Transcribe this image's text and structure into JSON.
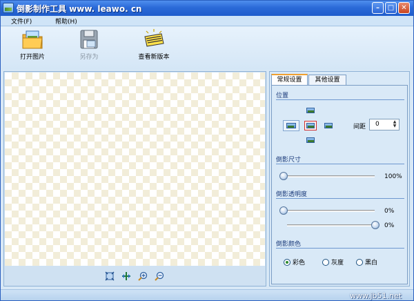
{
  "window": {
    "title": "倒影制作工具 www. leawo. cn",
    "minimize_icon": "minimize-icon",
    "maximize_icon": "maximize-icon",
    "close_icon": "close-icon"
  },
  "menu": {
    "file": "文件(F)",
    "help": "帮助(H)"
  },
  "toolbar": {
    "open_label": "打开图片",
    "saveas_label": "另存为",
    "new_version_label": "查看新版本",
    "open_icon": "folder-image-icon",
    "saveas_icon": "floppy-disk-icon",
    "new_version_icon": "new-version-badge-icon"
  },
  "preview": {
    "zoom_buttons": [
      "fit-to-window-icon",
      "actual-size-icon",
      "zoom-in-icon",
      "zoom-out-icon"
    ]
  },
  "settings": {
    "tabs": [
      {
        "label": "常规设置",
        "active": true
      },
      {
        "label": "其他设置",
        "active": false
      }
    ],
    "position": {
      "title": "位置",
      "selected": "bottom",
      "gap_label": "间距",
      "gap_value": "0"
    },
    "size": {
      "title": "倒影尺寸",
      "value": 100,
      "value_text": "100%"
    },
    "opacity": {
      "title": "倒影透明度",
      "start_value": 0,
      "start_text": "0%",
      "end_value": 0,
      "end_text": "0%"
    },
    "color": {
      "title": "倒影颜色",
      "options": [
        "彩色",
        "灰度",
        "黑白"
      ],
      "selected": "彩色"
    }
  },
  "status": {
    "watermark": "www.jb51.net"
  },
  "colors": {
    "title_bar": "#2b6ad8",
    "accent_tab": "#f0a030",
    "selected_position_border": "#d03030"
  }
}
